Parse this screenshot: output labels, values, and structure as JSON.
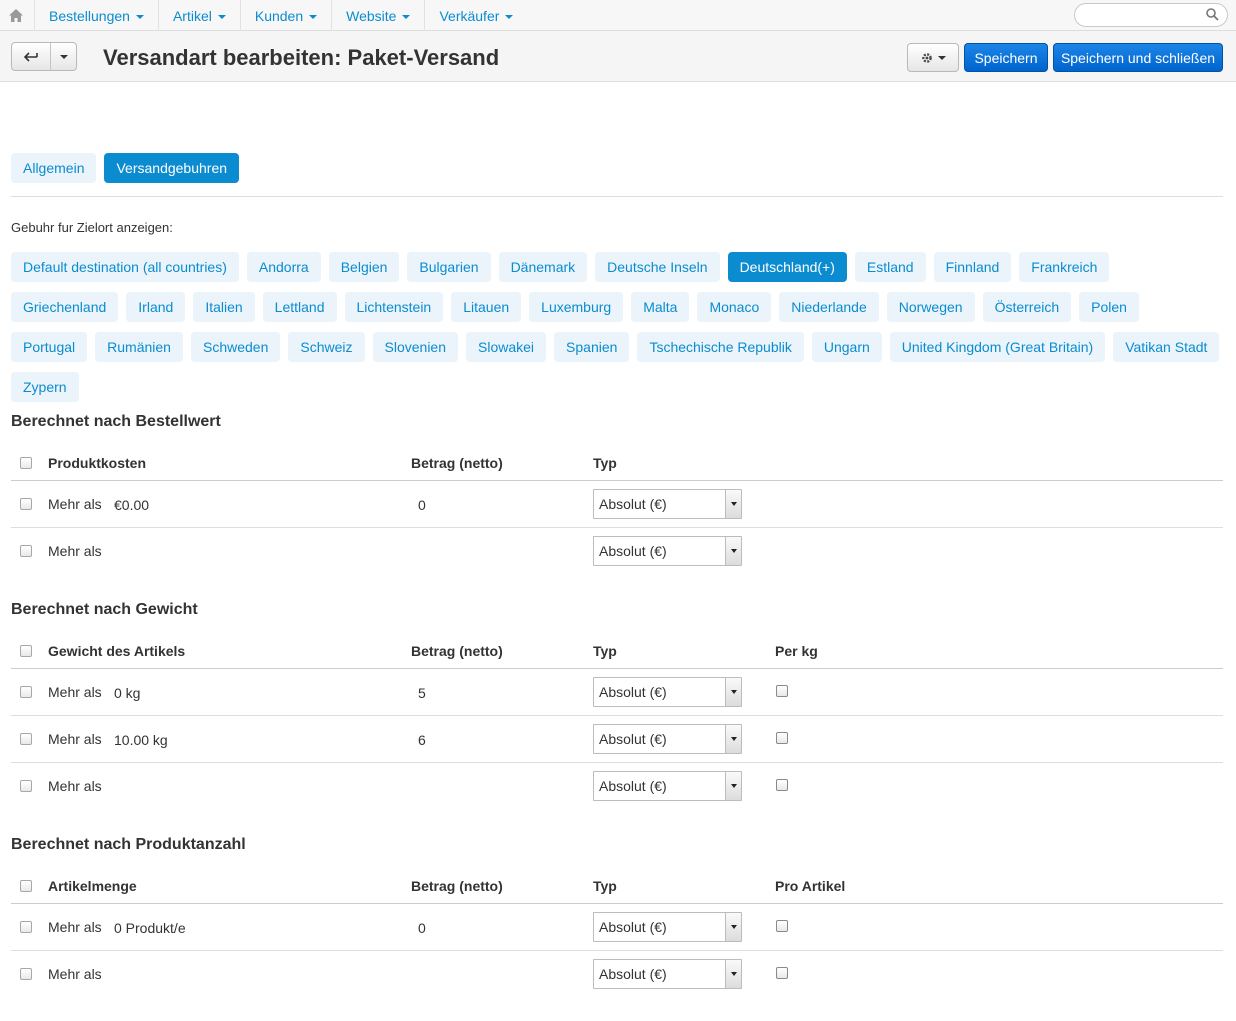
{
  "nav": {
    "home_icon": "home-icon",
    "items": [
      "Bestellungen",
      "Artikel",
      "Kunden",
      "Website",
      "Verkäufer"
    ],
    "search_placeholder": ""
  },
  "header": {
    "title": "Versandart bearbeiten: Paket-Versand",
    "save_label": "Speichern",
    "save_close_label": "Speichern und schließen"
  },
  "tabs": [
    {
      "label": "Allgemein",
      "active": false
    },
    {
      "label": "Versandgebuhren",
      "active": true
    }
  ],
  "destinations": {
    "label": "Gebuhr fur Zielort anzeigen:",
    "items": [
      "Default destination (all countries)",
      "Andorra",
      "Belgien",
      "Bulgarien",
      "Dänemark",
      "Deutsche Inseln",
      "Deutschland(+)",
      "Estland",
      "Finnland",
      "Frankreich",
      "Griechenland",
      "Irland",
      "Italien",
      "Lettland",
      "Lichtenstein",
      "Litauen",
      "Luxemburg",
      "Malta",
      "Monaco",
      "Niederlande",
      "Norwegen",
      "Österreich",
      "Polen",
      "Portugal",
      "Rumänien",
      "Schweden",
      "Schweiz",
      "Slovenien",
      "Slowakei",
      "Spanien",
      "Tschechische Republik",
      "Ungarn",
      "United Kingdom (Great Britain)",
      "Vatikan Stadt",
      "Zypern"
    ],
    "active": "Deutschland(+)"
  },
  "sections": {
    "order_value": {
      "title": "Berechnet nach Bestellwert",
      "col_condition": "Produktkosten",
      "col_amount": "Betrag (netto)",
      "col_type": "Typ",
      "rows": [
        {
          "prefix": "Mehr als",
          "condition": "€0.00",
          "amount": "0",
          "type": "Absolut (€)"
        },
        {
          "prefix": "Mehr als",
          "condition": "",
          "amount": "",
          "type": "Absolut (€)"
        }
      ]
    },
    "weight": {
      "title": "Berechnet nach Gewicht",
      "col_condition": "Gewicht des Artikels",
      "col_amount": "Betrag (netto)",
      "col_type": "Typ",
      "col_extra": "Per kg",
      "rows": [
        {
          "prefix": "Mehr als",
          "condition": "0 kg",
          "amount": "5",
          "type": "Absolut (€)"
        },
        {
          "prefix": "Mehr als",
          "condition": "10.00 kg",
          "amount": "6",
          "type": "Absolut (€)"
        },
        {
          "prefix": "Mehr als",
          "condition": "",
          "amount": "",
          "type": "Absolut (€)"
        }
      ]
    },
    "quantity": {
      "title": "Berechnet nach Produktanzahl",
      "col_condition": "Artikelmenge",
      "col_amount": "Betrag (netto)",
      "col_type": "Typ",
      "col_extra": "Pro Artikel",
      "rows": [
        {
          "prefix": "Mehr als",
          "condition": "0 Produkt/e",
          "amount": "0",
          "type": "Absolut (€)"
        },
        {
          "prefix": "Mehr als",
          "condition": "",
          "amount": "",
          "type": "Absolut (€)"
        }
      ]
    }
  }
}
